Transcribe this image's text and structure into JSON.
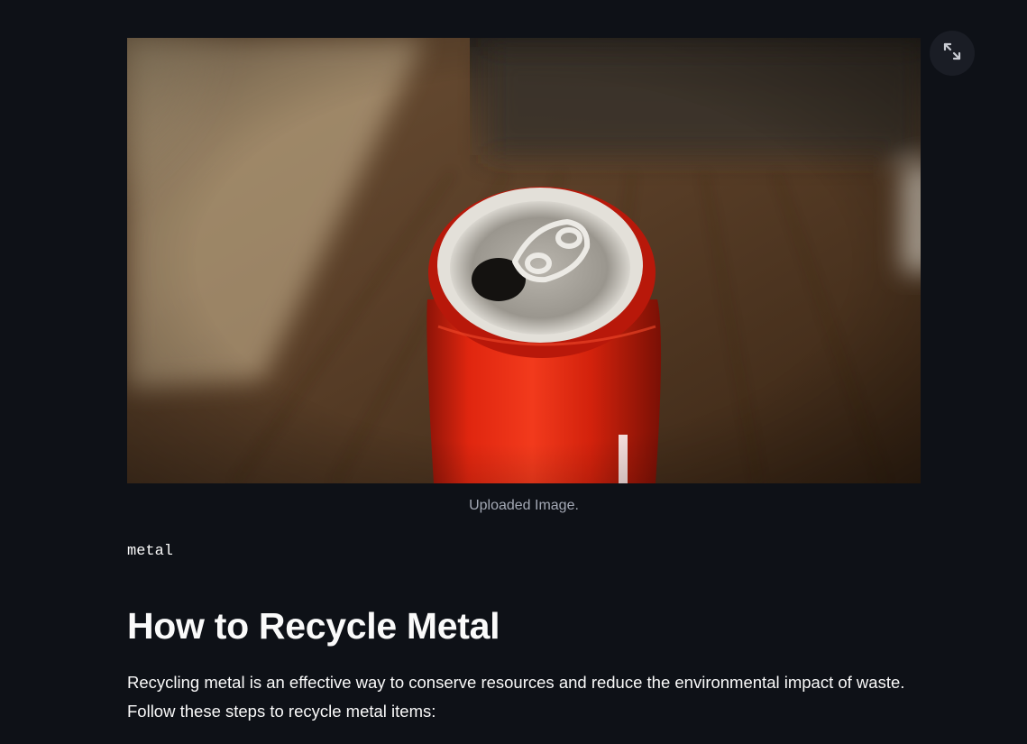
{
  "image": {
    "alt": "Red soda can on a wooden table",
    "caption": "Uploaded Image."
  },
  "fullscreen": {
    "icon": "expand-icon"
  },
  "prediction": {
    "label": "metal"
  },
  "article": {
    "title": "How to Recycle Metal",
    "intro_line1": "Recycling metal is an effective way to conserve resources and reduce the environmental impact of waste.",
    "intro_line2": "Follow these steps to recycle metal items:"
  },
  "colors": {
    "background": "#0e1117",
    "text": "#fafafa",
    "caption": "#a3a8b4",
    "button_bg": "#1a1d25"
  }
}
